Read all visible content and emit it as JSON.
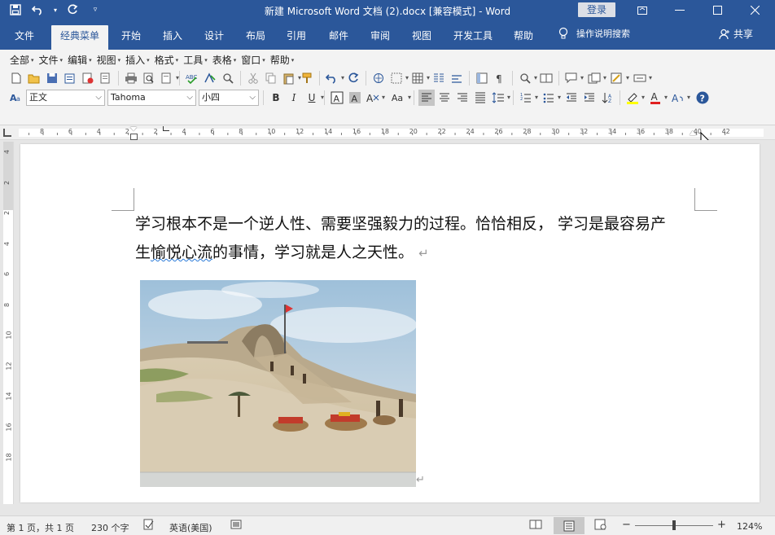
{
  "window": {
    "title": "新建 Microsoft Word 文档 (2).docx [兼容模式]  -  Word",
    "login_label": "登录"
  },
  "tabs": [
    {
      "label": "文件"
    },
    {
      "label": "经典菜单"
    },
    {
      "label": "开始"
    },
    {
      "label": "插入"
    },
    {
      "label": "设计"
    },
    {
      "label": "布局"
    },
    {
      "label": "引用"
    },
    {
      "label": "邮件"
    },
    {
      "label": "审阅"
    },
    {
      "label": "视图"
    },
    {
      "label": "开发工具"
    },
    {
      "label": "帮助"
    }
  ],
  "tellme": {
    "label": "操作说明搜索"
  },
  "share": {
    "label": "共享"
  },
  "menus": [
    {
      "label": "全部"
    },
    {
      "label": "文件"
    },
    {
      "label": "编辑"
    },
    {
      "label": "视图"
    },
    {
      "label": "插入"
    },
    {
      "label": "格式"
    },
    {
      "label": "工具"
    },
    {
      "label": "表格"
    },
    {
      "label": "窗口"
    },
    {
      "label": "帮助"
    }
  ],
  "format": {
    "style": "正文",
    "font": "Tahoma",
    "size": "小四",
    "bold": "B",
    "italic": "I",
    "underline": "U",
    "case_label": "Aa"
  },
  "ruler": {
    "h_ticks": [
      "8",
      "6",
      "4",
      "2",
      "2",
      "4",
      "6",
      "8",
      "10",
      "12",
      "14",
      "16",
      "18",
      "20",
      "22",
      "24",
      "26",
      "28",
      "30",
      "32",
      "34",
      "36",
      "38",
      "40",
      "42"
    ],
    "v_ticks": [
      "4",
      "2",
      "2",
      "4",
      "6",
      "8",
      "10",
      "12",
      "14",
      "16",
      "18"
    ]
  },
  "document": {
    "line1": "学习根本不是一个逆人性、需要坚强毅力的过程。恰恰相反， 学习是最容易产",
    "line2_before": "生",
    "line2_squiggle": "愉悦心流",
    "line2_after": "的事情，学习就是人之天性。",
    "para_mark": "↵"
  },
  "status": {
    "page": "第 1 页，共 1 页",
    "words": "230 个字",
    "language": "英语(美国)",
    "zoom": "124%"
  },
  "colors": {
    "brand": "#2b579a",
    "highlight": "#ffff00",
    "font_color": "#e02020"
  }
}
